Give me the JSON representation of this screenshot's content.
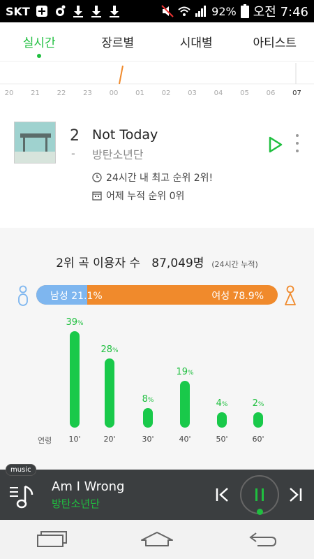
{
  "status_bar": {
    "carrier": "SKT",
    "battery": "92%",
    "time": "오전 7:46"
  },
  "tabs": [
    {
      "label": "실시간",
      "active": true
    },
    {
      "label": "장르별",
      "active": false
    },
    {
      "label": "시대별",
      "active": false
    },
    {
      "label": "아티스트",
      "active": false
    }
  ],
  "timeline": {
    "hours": [
      "20",
      "21",
      "22",
      "23",
      "00",
      "01",
      "02",
      "03",
      "04",
      "05",
      "06",
      "07"
    ],
    "current_hour": "07"
  },
  "song": {
    "rank": "2",
    "rank_change": "-",
    "title": "Not Today",
    "artist": "방탄소년단",
    "info_24h": "24시간 내 최고 순위 2위!",
    "info_yesterday": "어제 누적 순위 0위",
    "accent_color": "#1fbf3f"
  },
  "stats": {
    "users_label": "2위 곡 이용자 수",
    "users_count": "87,049명",
    "users_note": "(24시간 누적)",
    "gender": {
      "male_label": "남성 21.1%",
      "female_label": "여성 78.9%",
      "male_pct": 21.1,
      "female_pct": 78.9,
      "male_color": "#7eb6ef",
      "female_color": "#f08a2c"
    },
    "age_axis_label": "연령"
  },
  "chart_data": {
    "type": "bar",
    "categories": [
      "10'",
      "20'",
      "30'",
      "40'",
      "50'",
      "60'"
    ],
    "values": [
      39,
      28,
      8,
      19,
      4,
      2
    ],
    "unit": "%",
    "xlabel": "연령",
    "ylim": [
      0,
      39
    ]
  },
  "player": {
    "tag": "music",
    "title": "Am I Wrong",
    "artist": "방탄소년단"
  }
}
